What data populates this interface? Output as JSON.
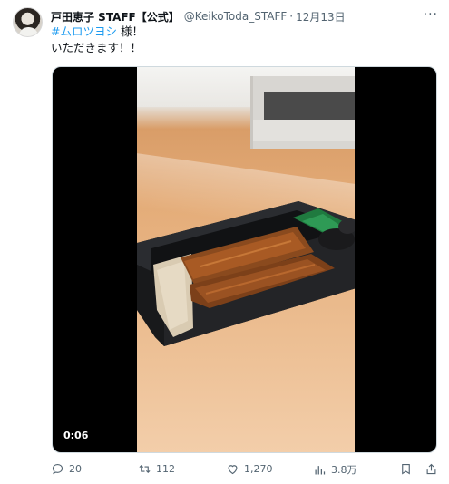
{
  "tweet": {
    "display_name": "戸田恵子 STAFF【公式】",
    "handle": "@KeikoToda_STAFF",
    "separator": "·",
    "date": "12月13日",
    "text_hashtag": "#ムロツヨシ",
    "text_line1_rest": " 様！",
    "text_line2": "いただきます！！",
    "more_label": "···"
  },
  "media": {
    "duration": "0:06"
  },
  "actions": {
    "replies": "20",
    "retweets": "112",
    "likes": "1,270",
    "views": "3.8万"
  },
  "icons": {
    "reply": "reply-icon",
    "retweet": "retweet-icon",
    "like": "heart-icon",
    "views": "views-icon",
    "bookmark": "bookmark-icon",
    "share": "share-icon"
  },
  "colors": {
    "link": "#1d9bf0",
    "muted": "#536471",
    "text": "#0f1419"
  }
}
